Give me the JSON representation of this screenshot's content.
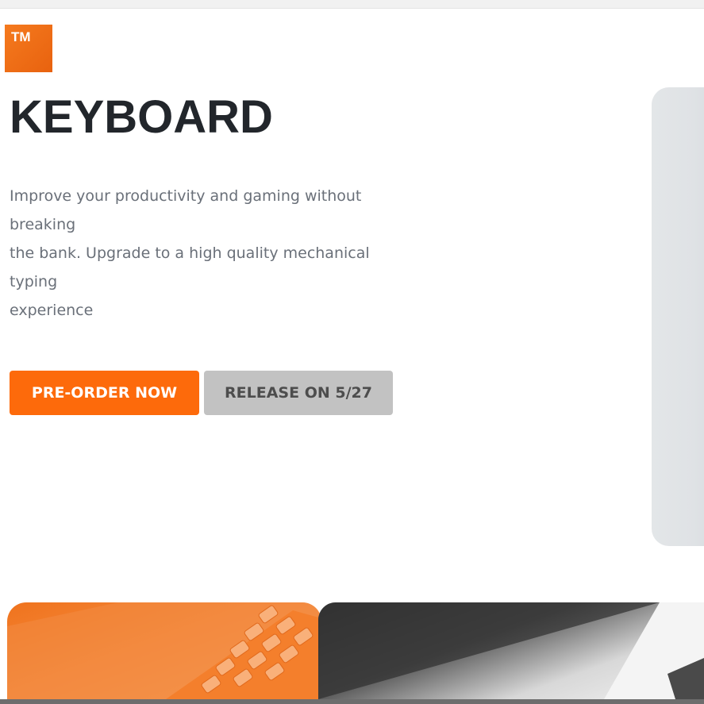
{
  "logo": {
    "text": "TM",
    "icon": "trademark-logo"
  },
  "hero": {
    "title": "KEYBOARD",
    "description_lines": [
      "Improve your productivity and gaming without",
      "breaking",
      "the bank. Upgrade to a high quality mechanical",
      "typing",
      "experience"
    ],
    "primary_button_label": "PRE-ORDER NOW",
    "secondary_button_label": "RELEASE ON 5/27",
    "image": "keyboard-product-image"
  },
  "gallery": {
    "cards": [
      {
        "image": "orange-keyboard-photo"
      },
      {
        "image": "gray-keyboard-photo"
      }
    ]
  },
  "colors": {
    "accent": "#fd6a0b",
    "logo": "#f57a1e",
    "secondary_button": "#c2c2c2",
    "title_text": "#22262b",
    "body_text": "#6a7079"
  }
}
